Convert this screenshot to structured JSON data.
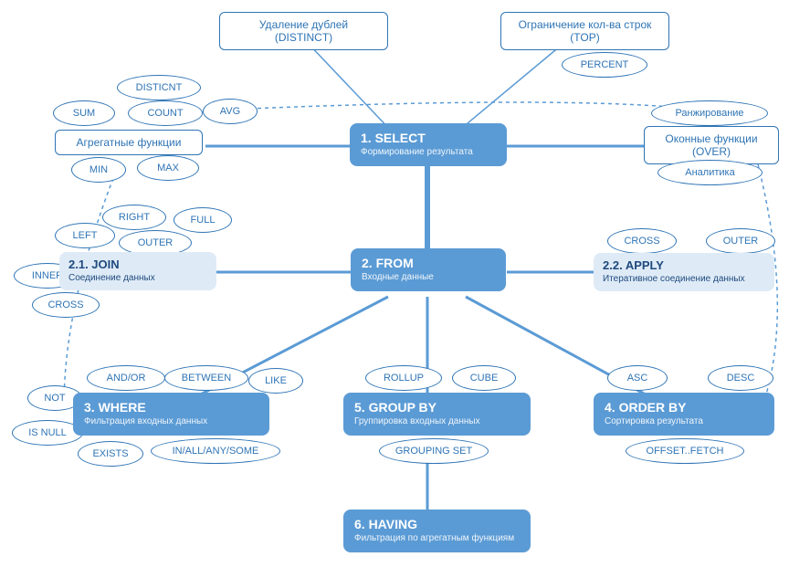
{
  "nodes": {
    "select": {
      "title": "1. SELECT",
      "sub": "Формирование результата"
    },
    "from": {
      "title": "2. FROM",
      "sub": "Входные данные"
    },
    "join": {
      "title": "2.1. JOIN",
      "sub": "Соединение данных"
    },
    "apply": {
      "title": "2.2. APPLY",
      "sub": "Итеративное соединение данных"
    },
    "where": {
      "title": "3. WHERE",
      "sub": "Фильтрация входных данных"
    },
    "groupby": {
      "title": "5. GROUP BY",
      "sub": "Группировка входных данных"
    },
    "orderby": {
      "title": "4. ORDER BY",
      "sub": "Сортировка результата"
    },
    "having": {
      "title": "6. HAVING",
      "sub": "Фильтрация по агрегатным функциям"
    }
  },
  "boxes": {
    "distinct": "Удаление дублей (DISTINCT)",
    "top": "Ограничение кол-ва строк (TOP)",
    "agg_fn": "Агрегатные функции",
    "window_fn": "Оконные функции (OVER)"
  },
  "pills": {
    "percent": "PERCENT",
    "distinct2": "DISTICNT",
    "sum": "SUM",
    "count": "COUNT",
    "avg": "AVG",
    "min": "MIN",
    "max": "MAX",
    "ranking": "Ранжирование",
    "analytics": "Аналитика",
    "left": "LEFT",
    "right": "RIGHT",
    "full": "FULL",
    "outer": "OUTER",
    "inner": "INNER",
    "cross": "CROSS",
    "apply_cross": "CROSS",
    "apply_outer": "OUTER",
    "and_or": "AND/OR",
    "between": "BETWEEN",
    "like": "LIKE",
    "not": "NOT",
    "is_null": "IS NULL",
    "exists": "EXISTS",
    "in_all": "IN/ALL/ANY/SOME",
    "rollup": "ROLLUP",
    "cube": "CUBE",
    "grp_set": "GROUPING SET",
    "asc": "ASC",
    "desc": "DESC",
    "offset": "OFFSET..FETCH"
  }
}
